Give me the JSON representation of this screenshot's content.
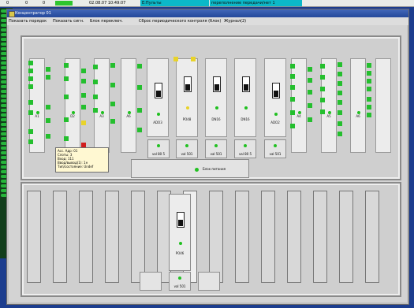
{
  "top": {
    "counts": [
      "0",
      "0",
      "0"
    ],
    "timestamp": "02.08.07 10:49:07",
    "source": "E:Пульты",
    "message": "переполнение передачи/нет 1"
  },
  "window": {
    "title": "Концентратор 01",
    "menu": [
      "Показать порядок",
      "Показать сигн.",
      "Блок переключ.",
      "Сброс периодического контроля (блок)",
      "Журнал(2)"
    ]
  },
  "racks": [
    {
      "label": "A1"
    },
    {
      "label": "D2"
    },
    {
      "label": "A3"
    },
    {
      "label": "A6"
    },
    {
      "label": "ADO3"
    },
    {
      "label": "PO48"
    },
    {
      "label": "DN16"
    },
    {
      "label": "DN16"
    },
    {
      "label": "ADO2"
    },
    {
      "label": "A4"
    },
    {
      "label": "A5"
    },
    {
      "label": "A6"
    }
  ],
  "modules": [
    {
      "label": "val 80 5"
    },
    {
      "label": "val 501"
    },
    {
      "label": "val 501"
    },
    {
      "label": "val 80 5"
    },
    {
      "label": "val 501"
    }
  ],
  "tooltip": [
    "Acc. Адр: 01",
    "Слоты: 3",
    "Вход: 111",
    "Ввод/вывод(1): 1н",
    "Тип/состояние: Undef"
  ],
  "central_button": "Блок питания",
  "lower_panel": {
    "module_label": "PO46",
    "module_code": "val 501"
  },
  "colors": {
    "led": "#20c020",
    "warning": "#e8d32a",
    "alarm": "#d11d1d",
    "titlebar": "#24489b"
  }
}
